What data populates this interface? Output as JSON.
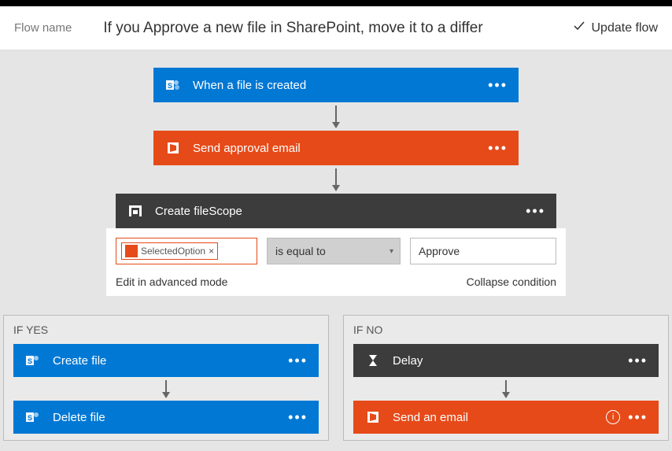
{
  "header": {
    "flow_label": "Flow name",
    "flow_title": "If you Approve a new file in SharePoint, move it to a differ",
    "update_button": "Update flow"
  },
  "steps": {
    "trigger": {
      "title": "When a file is created",
      "icon": "sharepoint"
    },
    "action1": {
      "title": "Send approval email",
      "icon": "office"
    },
    "scope": {
      "title": "Create fileScope",
      "icon": "scope"
    }
  },
  "condition": {
    "token_label": "SelectedOption",
    "token_close": "×",
    "operator": "is equal to",
    "value": "Approve",
    "edit_link": "Edit in advanced mode",
    "collapse_link": "Collapse condition"
  },
  "branches": {
    "yes": {
      "label": "IF YES",
      "steps": [
        {
          "title": "Create file",
          "color": "blue",
          "icon": "sharepoint"
        },
        {
          "title": "Delete file",
          "color": "blue",
          "icon": "sharepoint"
        }
      ]
    },
    "no": {
      "label": "IF NO",
      "steps": [
        {
          "title": "Delay",
          "color": "dark",
          "icon": "hourglass"
        },
        {
          "title": "Send an email",
          "color": "orange",
          "icon": "office",
          "info": true
        }
      ]
    }
  }
}
